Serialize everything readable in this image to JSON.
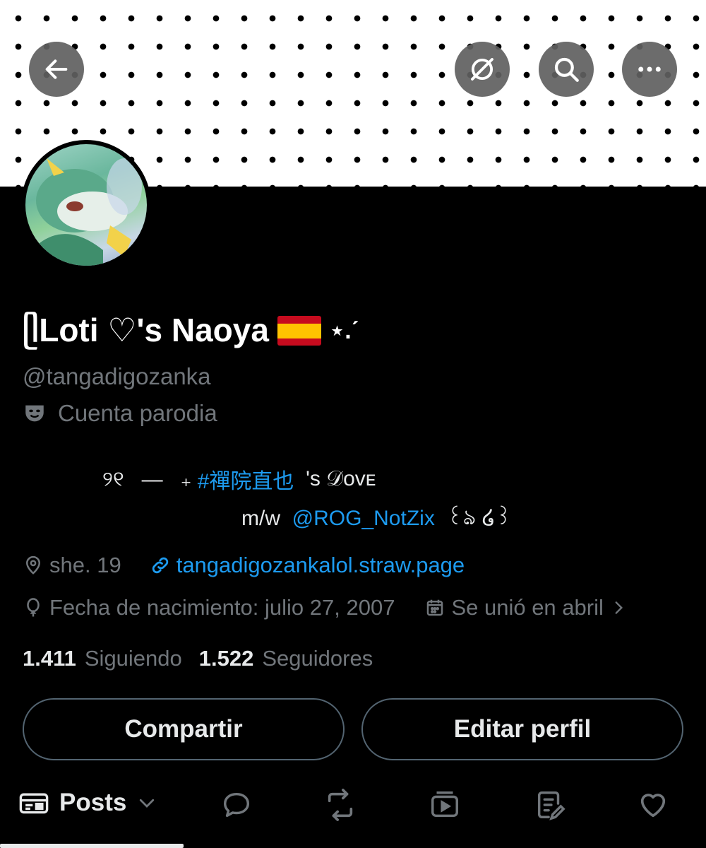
{
  "profile": {
    "display_name": "ᥫLoti ♡'s Naoya",
    "display_name_suffix": "⋆.ˊ",
    "handle": "@tangadigozanka",
    "parody_label": "Cuenta parodia"
  },
  "bio": {
    "line1_prefix": "୨୧   —   ₊ ",
    "hashtag": "#禪院直也",
    "line1_suffix": "  's 𝒟ᴏᴠᴇ",
    "line2_prefix": "m/w  ",
    "mention": "@ROG_NotZix",
    "line2_suffix": "  ꒰ঌ ໒꒱"
  },
  "meta": {
    "location": "she. 19",
    "website": "tangadigozankalol.straw.page",
    "birthday": "Fecha de nacimiento: julio 27, 2007",
    "joined": "Se unió en abril"
  },
  "stats": {
    "following_count": "1.411",
    "following_label": "Siguiendo",
    "followers_count": "1.522",
    "followers_label": "Seguidores"
  },
  "actions": {
    "share_label": "Compartir",
    "edit_label": "Editar perfil"
  },
  "tabs": {
    "posts_label": "Posts"
  },
  "icons": {
    "back": "arrow-left-icon",
    "grok": "grok-icon",
    "search": "search-icon",
    "more": "more-icon",
    "location": "location-icon",
    "link": "link-icon",
    "birthday": "balloon-icon",
    "calendar": "calendar-icon",
    "parody": "theater-mask-icon"
  },
  "colors": {
    "background": "#000000",
    "text": "#e7e9ea",
    "muted": "#71767b",
    "accent": "#1d9bf0",
    "border": "#536471"
  }
}
